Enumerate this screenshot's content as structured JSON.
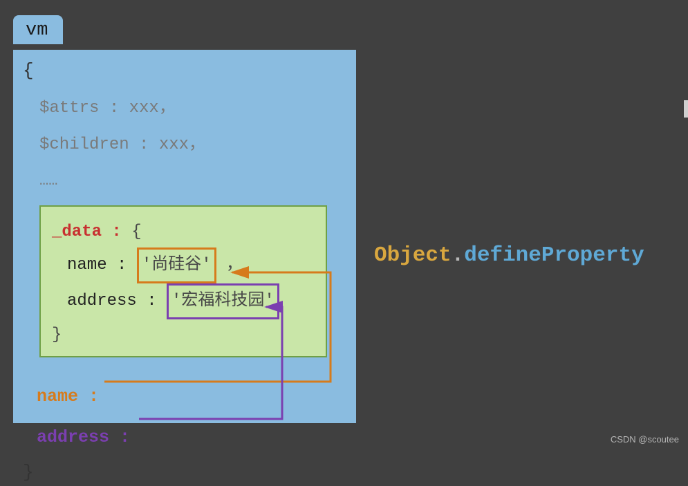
{
  "tab": {
    "label": "vm"
  },
  "panel": {
    "open": "{",
    "attrs": "$attrs : xxx，",
    "children": "$children : xxx，",
    "ellipsis": "……",
    "data": {
      "key": "_data :",
      "open": "{",
      "name_key": "name :",
      "name_val": "'尚硅谷'",
      "name_comma": "，",
      "addr_key": "address :",
      "addr_val": "'宏福科技园'",
      "close": "}"
    },
    "proxy_name": "name :",
    "proxy_addr": "address :",
    "close": "}"
  },
  "method": {
    "obj": "Object",
    "dot": ".",
    "def": "defineProperty"
  },
  "watermark": "CSDN @scoutee",
  "arrows": {
    "orange_color": "#d67b1c",
    "purple_color": "#7b3fb0"
  }
}
